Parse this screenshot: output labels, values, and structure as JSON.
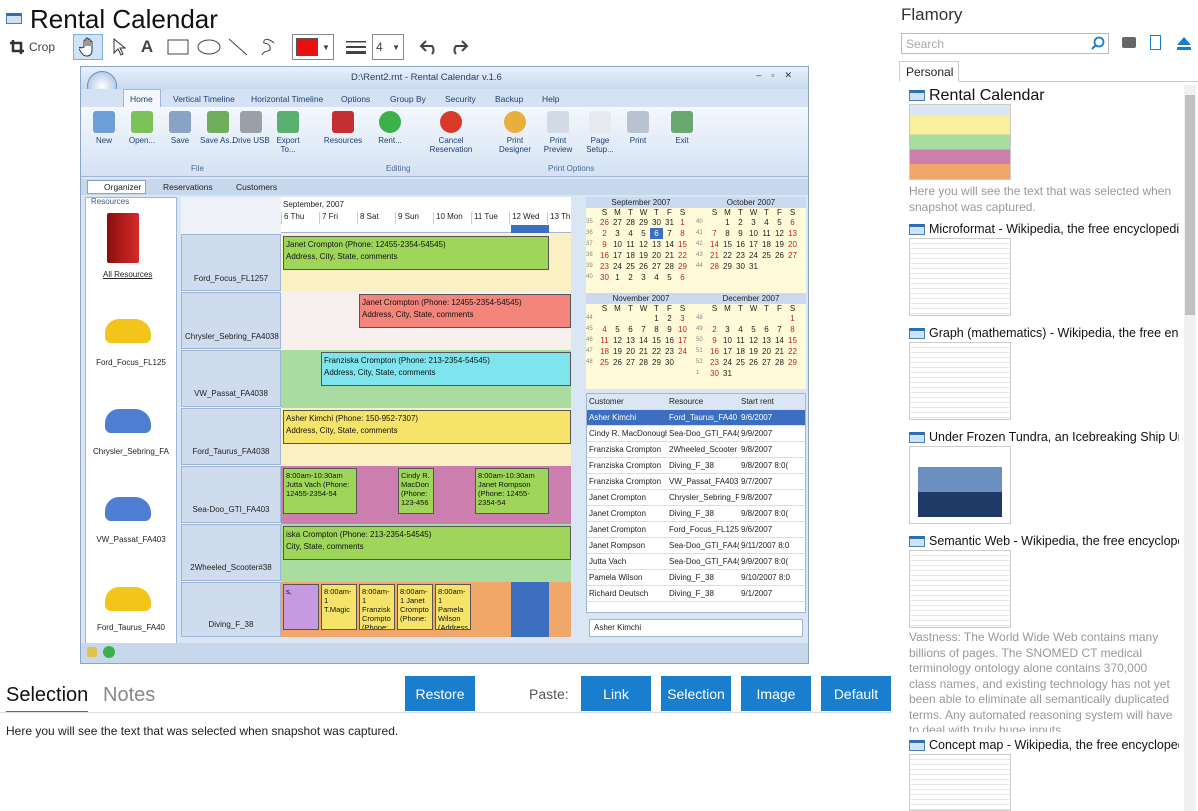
{
  "app": {
    "title": "Rental Calendar"
  },
  "toolbar": {
    "crop_label": "Crop",
    "line_width": "4",
    "color": "#e81010"
  },
  "screenshot": {
    "window_title": "D:\\Rent2.rnt - Rental Calendar v.1.6",
    "menu": [
      "Home",
      "Vertical Timeline",
      "Horizontal Timeline",
      "Options",
      "Group By",
      "Security",
      "Backup",
      "Help"
    ],
    "ribbon": [
      {
        "label": "New"
      },
      {
        "label": "Open..."
      },
      {
        "label": "Save"
      },
      {
        "label": "Save As..."
      },
      {
        "label": "Drive USB"
      },
      {
        "label": "Export To..."
      },
      {
        "label": "Resources"
      },
      {
        "label": "Rent..."
      },
      {
        "label": "Cancel Reservation"
      },
      {
        "label": "Print Designer"
      },
      {
        "label": "Print Preview"
      },
      {
        "label": "Page Setup..."
      },
      {
        "label": "Print"
      },
      {
        "label": "Exit"
      }
    ],
    "groups": {
      "file": "File",
      "editing": "Editing",
      "print_options": "Print Options"
    },
    "tabs": [
      "Organizer",
      "Reservations",
      "Customers"
    ],
    "resources_header": "Resources",
    "all_resources": "All Resources",
    "side_cars": [
      "Ford_Focus_FL125",
      "Chrysler_Sebring_FA",
      "VW_Passat_FA403",
      "Ford_Taurus_FA40"
    ],
    "month_label": "September, 2007",
    "days": [
      "6 Thu",
      "7 Fri",
      "8 Sat",
      "9 Sun",
      "10 Mon",
      "11 Tue",
      "12 Wed",
      "13 Th"
    ],
    "resources": [
      "Ford_Focus_FL1257",
      "Chrysler_Sebring_FA4038",
      "VW_Passat_FA4038",
      "Ford_Taurus_FA4038",
      "Sea-Doo_GTI_FA403",
      "2Wheeled_Scooter#38",
      "Diving_F_38"
    ],
    "bars": [
      {
        "l1": "Janet Crompton (Phone: 12455-2354-54545)",
        "l2": "Address, City, State, comments"
      },
      {
        "l1": "Janet Crompton (Phone: 12455-2354-54545)",
        "l2": "Address, City, State, comments"
      },
      {
        "l1": "Franziska Crompton (Phone: 213-2354-54545)",
        "l2": "Address, City, State, comments"
      },
      {
        "l1": "Asher Kimchi (Phone: 150-952-7307)",
        "l2": "Address, City, State, comments"
      },
      {
        "l1": "iska Crompton (Phone: 213-2354-54545)",
        "l2": "City, State, comments"
      }
    ],
    "seadoo": [
      {
        "t": "8:00am-10:30am Jutta Vach (Phone: 12455-2354-54"
      },
      {
        "t": "Cindy R. MacDon (Phone: 123-456"
      },
      {
        "t": "8:00am-10:30am Janet Rompson (Phone: 12455-2354-54"
      }
    ],
    "diving": [
      {
        "t": "s,"
      },
      {
        "t": "8:00am-1 T.Magic"
      },
      {
        "t": "8:00am-1 Franzisk Crompto (Phone:"
      },
      {
        "t": "8:00am-1 Janet Crompto (Phone:"
      },
      {
        "t": "8:00am-1 Pamela Wilson (Address"
      }
    ],
    "calendars": [
      {
        "title": "September 2007",
        "dow": [
          "S",
          "M",
          "T",
          "W",
          "T",
          "F",
          "S"
        ],
        "weeks": [
          [
            "35",
            "26",
            "27",
            "28",
            "29",
            "30",
            "31",
            "1"
          ],
          [
            "36",
            "2",
            "3",
            "4",
            "5",
            "6",
            "7",
            "8"
          ],
          [
            "37",
            "9",
            "10",
            "11",
            "12",
            "13",
            "14",
            "15"
          ],
          [
            "38",
            "16",
            "17",
            "18",
            "19",
            "20",
            "21",
            "22"
          ],
          [
            "39",
            "23",
            "24",
            "25",
            "26",
            "27",
            "28",
            "29"
          ],
          [
            "40",
            "30",
            "1",
            "2",
            "3",
            "4",
            "5",
            "6"
          ]
        ]
      },
      {
        "title": "October 2007",
        "dow": [
          "S",
          "M",
          "T",
          "W",
          "T",
          "F",
          "S"
        ],
        "weeks": [
          [
            "40",
            "",
            "1",
            "2",
            "3",
            "4",
            "5",
            "6"
          ],
          [
            "41",
            "7",
            "8",
            "9",
            "10",
            "11",
            "12",
            "13"
          ],
          [
            "42",
            "14",
            "15",
            "16",
            "17",
            "18",
            "19",
            "20"
          ],
          [
            "43",
            "21",
            "22",
            "23",
            "24",
            "25",
            "26",
            "27"
          ],
          [
            "44",
            "28",
            "29",
            "30",
            "31",
            "",
            "",
            ""
          ]
        ]
      },
      {
        "title": "November 2007",
        "dow": [
          "S",
          "M",
          "T",
          "W",
          "T",
          "F",
          "S"
        ],
        "weeks": [
          [
            "44",
            "",
            "",
            "",
            "",
            "1",
            "2",
            "3"
          ],
          [
            "45",
            "4",
            "5",
            "6",
            "7",
            "8",
            "9",
            "10"
          ],
          [
            "46",
            "11",
            "12",
            "13",
            "14",
            "15",
            "16",
            "17"
          ],
          [
            "47",
            "18",
            "19",
            "20",
            "21",
            "22",
            "23",
            "24"
          ],
          [
            "48",
            "25",
            "26",
            "27",
            "28",
            "29",
            "30",
            ""
          ]
        ]
      },
      {
        "title": "December 2007",
        "dow": [
          "S",
          "M",
          "T",
          "W",
          "T",
          "F",
          "S"
        ],
        "weeks": [
          [
            "48",
            "",
            "",
            "",
            "",
            "",
            "",
            "1"
          ],
          [
            "49",
            "2",
            "3",
            "4",
            "5",
            "6",
            "7",
            "8"
          ],
          [
            "50",
            "9",
            "10",
            "11",
            "12",
            "13",
            "14",
            "15"
          ],
          [
            "51",
            "16",
            "17",
            "18",
            "19",
            "20",
            "21",
            "22"
          ],
          [
            "52",
            "23",
            "24",
            "25",
            "26",
            "27",
            "28",
            "29"
          ],
          [
            "1",
            "30",
            "31",
            "",
            "",
            "",
            "",
            ""
          ]
        ]
      }
    ],
    "table": {
      "headers": [
        "Customer",
        "Resource",
        "Start rent"
      ],
      "rows": [
        [
          "Asher Kimchi",
          "Ford_Taurus_FA40",
          "9/6/2007"
        ],
        [
          "Cindy R. MacDonough",
          "Sea-Doo_GTI_FA4(",
          "9/9/2007"
        ],
        [
          "Franziska Crompton",
          "2Wheeled_Scooter",
          "9/8/2007"
        ],
        [
          "Franziska Crompton",
          "Diving_F_38",
          "9/8/2007 8:0("
        ],
        [
          "Franziska Crompton",
          "VW_Passat_FA403",
          "9/7/2007"
        ],
        [
          "Janet Crompton",
          "Chrysler_Sebring_F",
          "9/8/2007"
        ],
        [
          "Janet Crompton",
          "Diving_F_38",
          "9/8/2007 8:0("
        ],
        [
          "Janet Crompton",
          "Ford_Focus_FL125",
          "9/6/2007"
        ],
        [
          "Janet Rompson",
          "Sea-Doo_GTI_FA4(",
          "9/11/2007 8:0"
        ],
        [
          "Jutta Vach",
          "Sea-Doo_GTI_FA4(",
          "9/9/2007 8:0("
        ],
        [
          "Pamela Wilson",
          "Diving_F_38",
          "9/10/2007 8:0"
        ],
        [
          "Richard Deutsch",
          "Diving_F_38",
          "9/1/2007"
        ]
      ]
    },
    "search_value": "Asher Kimchi"
  },
  "bottom": {
    "tab_selection": "Selection",
    "tab_notes": "Notes",
    "restore": "Restore",
    "paste_label": "Paste:",
    "link": "Link",
    "selection": "Selection",
    "image": "Image",
    "default": "Default",
    "selection_text": "Here you will see the text that was selected when snapshot was captured."
  },
  "right": {
    "app_name": "Flamory",
    "search_placeholder": "Search",
    "tab": "Personal",
    "cards": [
      {
        "title": "Rental Calendar",
        "snippet": "Here you will see the text that was selected when snapshot was captured."
      },
      {
        "title": "Microformat - Wikipedia, the free encyclopedia"
      },
      {
        "title": "Graph (mathematics) - Wikipedia, the free ency"
      },
      {
        "title": "Under Frozen Tundra, an Icebreaking Ship Unco"
      },
      {
        "title": "Semantic Web - Wikipedia, the free encycloped",
        "snippet": "Vastness: The World Wide Web contains many billions of pages. The SNOMED CT medical terminology ontology alone contains 370,000 class names, and existing technology has not yet been able to eliminate all semantically duplicated terms. Any automated reasoning system will have to deal with truly huge inputs."
      },
      {
        "title": "Concept map - Wikipedia, the free encyclopedi"
      }
    ]
  }
}
